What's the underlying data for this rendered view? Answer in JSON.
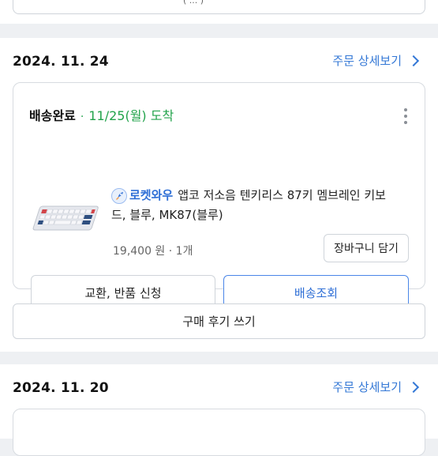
{
  "top_card": {
    "partial_text": "( ... )"
  },
  "orders": [
    {
      "date": "2024. 11. 24",
      "detail_link": "주문 상세보기",
      "status": "배송완료",
      "separator": "·",
      "arrival": "11/25(월) 도착",
      "product": {
        "badge": "로켓와우",
        "name_line1": "앱코 저소음 텐키리스 87키 멤브레인 키보",
        "name_line2": "드, 블루, MK87(블루)",
        "price": "19,400 원 · 1개",
        "cart_button": "장바구니 담기"
      },
      "actions": {
        "exchange": "교환, 반품 신청",
        "tracking": "배송조회"
      },
      "review_button": "구매 후기 쓰기"
    },
    {
      "date": "2024. 11. 20",
      "detail_link": "주문 상세보기"
    }
  ],
  "colors": {
    "accent": "#3478d6",
    "arrival_green": "#22a34b",
    "page_bg": "#eef0f3"
  },
  "icons": {
    "rocket": "rocket-icon",
    "more": "more-vertical-icon",
    "chevron": "chevron-right-icon"
  }
}
